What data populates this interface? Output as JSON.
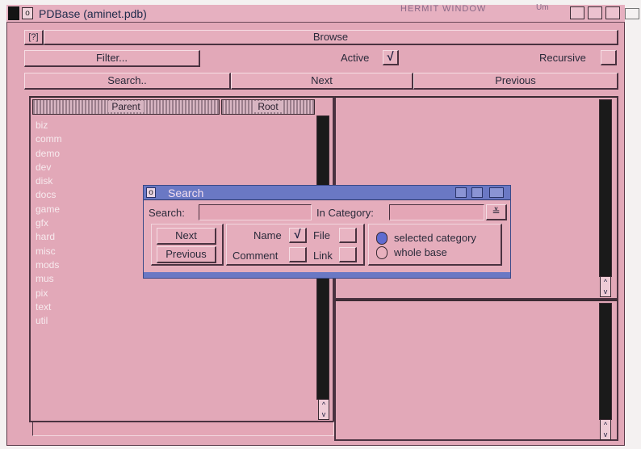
{
  "window": {
    "title": "PDBase (aminet.pdb)",
    "close_label": "o",
    "overlay_title": "HERMIT WINDOW",
    "overlay_extra": "Um"
  },
  "browse": {
    "icon_label": "[?]",
    "label": "Browse"
  },
  "filter_row": {
    "filter_label": "Filter...",
    "active_label": "Active",
    "active_mark": "√",
    "recursive_label": "Recursive"
  },
  "nav_row": {
    "search_label": "Search..",
    "next_label": "Next",
    "previous_label": "Previous"
  },
  "list_panel": {
    "parent_label": "Parent",
    "root_label": "Root",
    "items": [
      "biz",
      "comm",
      "demo",
      "dev",
      "disk",
      "docs",
      "game",
      "gfx",
      "hard",
      "misc",
      "mods",
      "mus",
      "pix",
      "text",
      "util"
    ]
  },
  "scroll_arrows": "^\nv",
  "search_dialog": {
    "title": "Search",
    "close_label": "o",
    "search_label": "Search:",
    "search_value": "",
    "category_label": "In Category:",
    "category_value": "",
    "popup_mark": "≚",
    "next_label": "Next",
    "previous_label": "Previous",
    "name_label": "Name",
    "name_mark": "√",
    "file_label": "File",
    "comment_label": "Comment",
    "link_label": "Link",
    "radio_selected_label": "selected category",
    "radio_whole_label": "whole base"
  },
  "colors": {
    "window_bg": "#e2a8b8",
    "search_titlebar": "#6a78c4",
    "list_text": "#f7eaee"
  }
}
